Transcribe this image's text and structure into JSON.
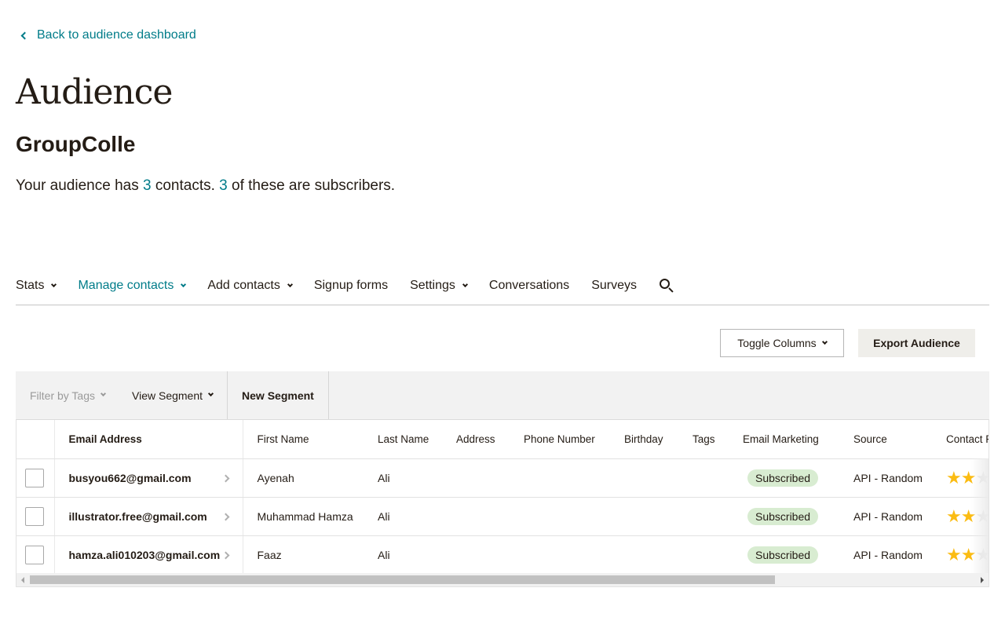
{
  "back_link": {
    "label": "Back to audience dashboard"
  },
  "header": {
    "title": "Audience",
    "audience_name": "GroupColle",
    "summary": {
      "prefix": "Your audience has ",
      "contacts_count": "3",
      "middle": " contacts. ",
      "subscribers_count": "3",
      "suffix": " of these are subscribers."
    }
  },
  "nav": {
    "items": [
      {
        "label": "Stats",
        "has_caret": true,
        "active": false
      },
      {
        "label": "Manage contacts",
        "has_caret": true,
        "active": true
      },
      {
        "label": "Add contacts",
        "has_caret": true,
        "active": false
      },
      {
        "label": "Signup forms",
        "has_caret": false,
        "active": false
      },
      {
        "label": "Settings",
        "has_caret": true,
        "active": false
      },
      {
        "label": "Conversations",
        "has_caret": false,
        "active": false
      },
      {
        "label": "Surveys",
        "has_caret": false,
        "active": false
      }
    ],
    "search_icon": "search-icon"
  },
  "toolbar": {
    "toggle_columns_label": "Toggle Columns",
    "export_label": "Export Audience"
  },
  "filter_bar": {
    "filter_by_tags": "Filter by Tags",
    "view_segment": "View Segment",
    "new_segment": "New Segment"
  },
  "table": {
    "columns": [
      "Email Address",
      "First Name",
      "Last Name",
      "Address",
      "Phone Number",
      "Birthday",
      "Tags",
      "Email Marketing",
      "Source",
      "Contact Rating"
    ],
    "rows": [
      {
        "email": "busyou662@gmail.com",
        "first_name": "Ayenah",
        "last_name": "Ali",
        "address": "",
        "phone": "",
        "birthday": "",
        "tags": "",
        "email_marketing": "Subscribed",
        "source": "API - Random",
        "rating": 2,
        "rating_max": 5
      },
      {
        "email": "illustrator.free@gmail.com",
        "first_name": "Muhammad Hamza",
        "last_name": "Ali",
        "address": "",
        "phone": "",
        "birthday": "",
        "tags": "",
        "email_marketing": "Subscribed",
        "source": "API - Random",
        "rating": 2,
        "rating_max": 5
      },
      {
        "email": "hamza.ali010203@gmail.com",
        "first_name": "Faaz",
        "last_name": "Ali",
        "address": "",
        "phone": "",
        "birthday": "",
        "tags": "",
        "email_marketing": "Subscribed",
        "source": "API - Random",
        "rating": 2,
        "rating_max": 5
      }
    ]
  },
  "colors": {
    "accent": "#007c89",
    "text": "#241c15",
    "badge_bg": "#d8ecd1",
    "star": "#fbbc13"
  }
}
